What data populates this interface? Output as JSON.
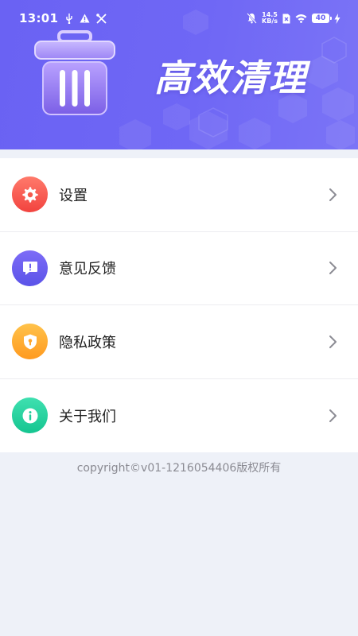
{
  "status_bar": {
    "time": "13:01",
    "net_speed_value": "14.5",
    "net_speed_unit": "KB/s",
    "battery_level": "40",
    "left_icons": [
      "usb-icon",
      "warning-icon",
      "tools-icon"
    ],
    "right_icons": [
      "mute-bell-icon",
      "sim-x-icon",
      "wifi-icon",
      "battery-icon",
      "charging-bolt-icon"
    ]
  },
  "header": {
    "title": "高效清理",
    "illustration_icon": "trash-can-icon",
    "colors": {
      "gradient_start": "#6a62f3",
      "gradient_end": "#7b74f6"
    }
  },
  "menu": {
    "items": [
      {
        "label": "设置",
        "icon": "gear-icon",
        "color_start": "#ff7a6b",
        "color_end": "#f2433f"
      },
      {
        "label": "意见反馈",
        "icon": "feedback-icon",
        "color_start": "#7d6cf7",
        "color_end": "#5b53e8"
      },
      {
        "label": "隐私政策",
        "icon": "shield-lock-icon",
        "color_start": "#ffc24a",
        "color_end": "#ff9a1f"
      },
      {
        "label": "关于我们",
        "icon": "info-icon",
        "color_start": "#3fe0b0",
        "color_end": "#15c590"
      }
    ],
    "chevron_icon": "chevron-right-icon"
  },
  "footer": {
    "copyright": "copyright©v01-1216054406版权所有"
  }
}
